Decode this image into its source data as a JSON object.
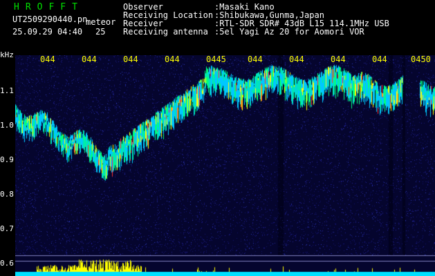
{
  "header": {
    "brand": "HROFFT",
    "filename": "UT2509290440.pn",
    "suffix": "meteor",
    "datetime": "25.09.29 04:40",
    "count": "25",
    "fields": [
      {
        "label": "Observer",
        "value": ":Masaki Kano"
      },
      {
        "label": "Receiving Location",
        "value": ":Shibukawa,Gunma,Japan"
      },
      {
        "label": "Receiver",
        "value": ":RTL-SDR SDR# 43dB L15 114.1MHz USB"
      },
      {
        "label": "Receiving antenna",
        "value": ":5el Yagi Az 20 for Aomori VOR"
      }
    ]
  },
  "axis": {
    "unit": "kHz",
    "y_labels": [
      "1.1",
      "1.0",
      "0.9",
      "0.8",
      "0.7",
      "0.6"
    ],
    "time_ticks": [
      "044",
      "044",
      "044",
      "044",
      "0445",
      "044",
      "044",
      "044",
      "044",
      "0450"
    ]
  },
  "colors": {
    "background": "#05052e",
    "noise": "#1a1a8a",
    "signal_low": "#00c8ff",
    "signal_mid": "#00ff80",
    "signal_high": "#ffff00",
    "signal_peak": "#ff3030",
    "bottom_bar": "#00e0ff",
    "bottom_peaks": "#ffff00"
  }
}
